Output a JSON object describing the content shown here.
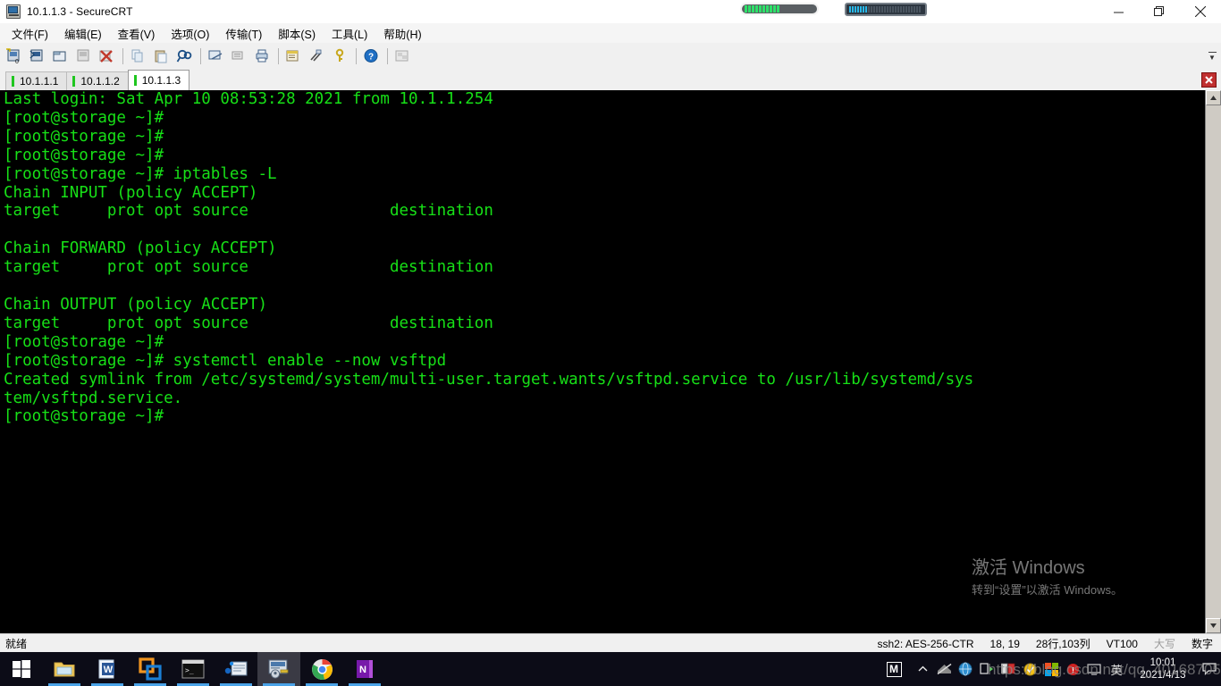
{
  "window": {
    "title": "10.1.1.3 - SecureCRT",
    "app_icon": "securecrt-icon",
    "minimize": "─",
    "maximize": "❐",
    "close": "✕"
  },
  "menu": {
    "items": [
      {
        "label": "文件(F)",
        "name": "menu-file"
      },
      {
        "label": "编辑(E)",
        "name": "menu-edit"
      },
      {
        "label": "查看(V)",
        "name": "menu-view"
      },
      {
        "label": "选项(O)",
        "name": "menu-options"
      },
      {
        "label": "传输(T)",
        "name": "menu-transfer"
      },
      {
        "label": "脚本(S)",
        "name": "menu-script"
      },
      {
        "label": "工具(L)",
        "name": "menu-tools"
      },
      {
        "label": "帮助(H)",
        "name": "menu-help"
      }
    ]
  },
  "toolbar": {
    "buttons": [
      {
        "name": "new-session-icon",
        "glyph": "⊞"
      },
      {
        "name": "connect-sftp-icon",
        "glyph": "⎇"
      },
      {
        "name": "new-tab-icon",
        "glyph": "▭"
      },
      {
        "name": "reconnect-icon",
        "glyph": "↻"
      },
      {
        "name": "disconnect-icon",
        "glyph": "✕"
      },
      {
        "name": "copy-icon",
        "glyph": "⧉"
      },
      {
        "name": "paste-icon",
        "glyph": "⎘"
      },
      {
        "name": "find-icon",
        "glyph": "⚲"
      },
      {
        "name": "print-screen-icon",
        "glyph": "⎙"
      },
      {
        "name": "log-session-icon",
        "glyph": "☷"
      },
      {
        "name": "print-icon",
        "glyph": "⎙"
      },
      {
        "name": "session-options-icon",
        "glyph": "✎"
      },
      {
        "name": "global-options-icon",
        "glyph": "⚙"
      },
      {
        "name": "key-icon",
        "glyph": "⚷"
      },
      {
        "name": "help-icon",
        "glyph": "?"
      },
      {
        "name": "arrange-icon",
        "glyph": "❐"
      }
    ],
    "overflow": "▾"
  },
  "tabs": {
    "items": [
      {
        "label": "10.1.1.1",
        "name": "tab-10-1-1-1",
        "active": false
      },
      {
        "label": "10.1.1.2",
        "name": "tab-10-1-1-2",
        "active": false
      },
      {
        "label": "10.1.1.3",
        "name": "tab-10-1-1-3",
        "active": true
      }
    ],
    "close_glyph": "✖"
  },
  "terminal": {
    "lines": [
      "Last login: Sat Apr 10 08:53:28 2021 from 10.1.1.254",
      "[root@storage ~]#",
      "[root@storage ~]#",
      "[root@storage ~]#",
      "[root@storage ~]# iptables -L",
      "Chain INPUT (policy ACCEPT)",
      "target     prot opt source               destination",
      "",
      "Chain FORWARD (policy ACCEPT)",
      "target     prot opt source               destination",
      "",
      "Chain OUTPUT (policy ACCEPT)",
      "target     prot opt source               destination",
      "[root@storage ~]#",
      "[root@storage ~]# systemctl enable --now vsftpd",
      "Created symlink from /etc/systemd/system/multi-user.target.wants/vsftpd.service to /usr/lib/systemd/sys",
      "tem/vsftpd.service.",
      "[root@storage ~]#"
    ],
    "foreground": "#17e017",
    "background": "#000000"
  },
  "watermark": {
    "activate_title": "激活 Windows",
    "activate_sub": "转到“设置”以激活 Windows。",
    "csdn": "https://blog.csdn.net/qq_40168705"
  },
  "statusbar": {
    "ready": "就绪",
    "cipher": "ssh2: AES-256-CTR",
    "cursor": "18, 19",
    "size": "28行,103列",
    "emulation": "VT100",
    "caps": "大写",
    "num": "数字"
  },
  "taskbar": {
    "items": [
      {
        "name": "start-button",
        "icon": "windows-logo-icon",
        "active": false,
        "running": false
      },
      {
        "name": "taskbar-file-explorer",
        "icon": "folder-icon",
        "active": false,
        "running": true
      },
      {
        "name": "taskbar-word",
        "icon": "word-icon",
        "active": false,
        "running": true
      },
      {
        "name": "taskbar-vmware",
        "icon": "vmware-icon",
        "active": false,
        "running": true
      },
      {
        "name": "taskbar-cmd",
        "icon": "command-prompt-icon",
        "active": false,
        "running": true
      },
      {
        "name": "taskbar-xshell",
        "icon": "xshell-icon",
        "active": false,
        "running": true
      },
      {
        "name": "taskbar-securecrt",
        "icon": "securecrt-icon",
        "active": true,
        "running": true
      },
      {
        "name": "taskbar-chrome",
        "icon": "chrome-icon",
        "active": false,
        "running": true
      },
      {
        "name": "taskbar-onenote",
        "icon": "onenote-icon",
        "active": false,
        "running": true
      }
    ],
    "tray": {
      "badge": "M",
      "show_hidden": "∧",
      "ime": "英",
      "time": "10:01",
      "date": "2021/4/13",
      "notifications": "὚0"
    }
  }
}
